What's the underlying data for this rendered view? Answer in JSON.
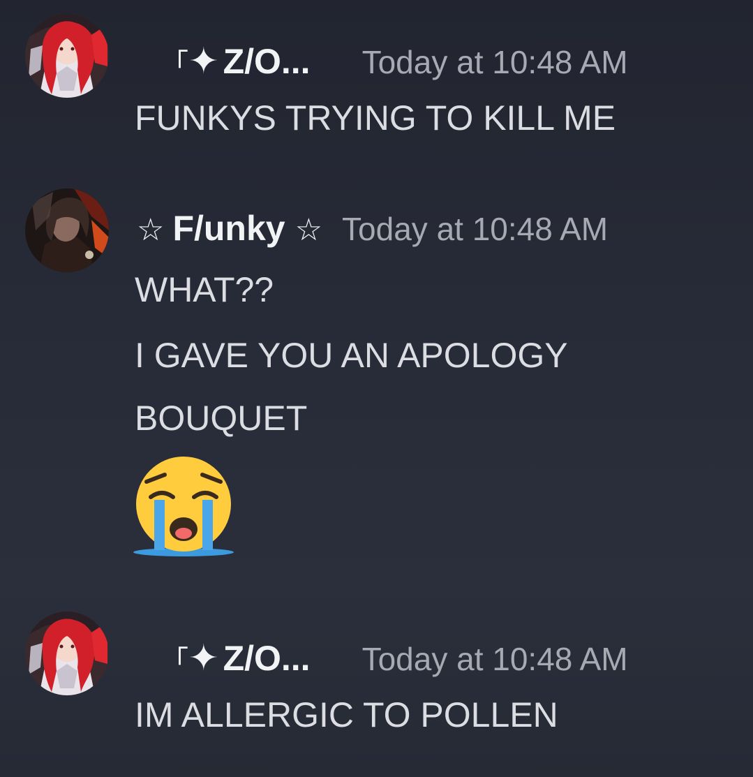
{
  "messages": [
    {
      "author_prefix": "「",
      "author_symbol": "✦",
      "author_name": "Z/O...",
      "timestamp": "Today at 10:48 AM",
      "lines": [
        "FUNKYS TRYING TO KILL ME"
      ],
      "avatar_icon": "red-haired-character-avatar"
    },
    {
      "author_prefix": "☆",
      "author_name": "F/unky",
      "author_suffix": "☆",
      "timestamp": "Today at 10:48 AM",
      "lines": [
        "WHAT??",
        "I GAVE YOU AN APOLOGY",
        "BOUQUET"
      ],
      "emoji": "loudly-crying-face",
      "avatar_icon": "dark-haired-character-avatar"
    },
    {
      "author_prefix": "「",
      "author_symbol": "✦",
      "author_name": "Z/O...",
      "timestamp": "Today at 10:48 AM",
      "lines": [
        "IM ALLERGIC TO POLLEN"
      ],
      "avatar_icon": "red-haired-character-avatar"
    }
  ],
  "colors": {
    "background": "#262a35",
    "username": "#f2f3f5",
    "timestamp": "#a7aab2",
    "message_text": "#dcdde2"
  }
}
